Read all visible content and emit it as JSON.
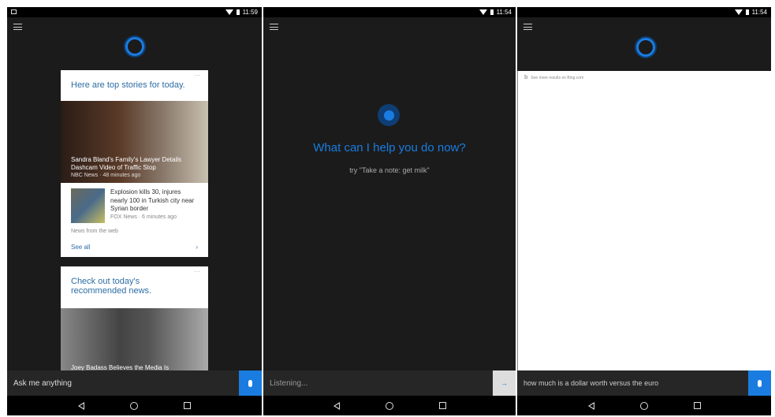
{
  "panels": [
    {
      "status_time": "11:59",
      "card1": {
        "title": "Here are top stories for today.",
        "more": "···",
        "hero_headline": "Sandra Bland's Family's Lawyer Details Dashcam Video of Traffic Stop",
        "hero_meta": "NBC News · 48 minutes ago",
        "story_headline": "Explosion kills 30, injures nearly 100 in Turkish city near Syrian border",
        "story_meta": "FOX News · 6 minutes ago",
        "source_note": "News from the web",
        "see_all": "See all"
      },
      "card2": {
        "title": "Check out today's recommended news.",
        "more": "···",
        "hero_headline": "Joey Badass Believes the Media Is"
      },
      "search_placeholder": "Ask me anything"
    },
    {
      "status_time": "11:54",
      "prompt": "What can I help you do now?",
      "hint": "try \"Take a note: get milk\"",
      "search_text": "Listening..."
    },
    {
      "status_time": "11:54",
      "bing_link": "See more results on Bing.com",
      "search_text": "how much is a dollar worth versus the euro"
    }
  ],
  "colors": {
    "accent": "#1a7ce0",
    "background": "#1b1b1b",
    "link": "#2e6da4"
  }
}
